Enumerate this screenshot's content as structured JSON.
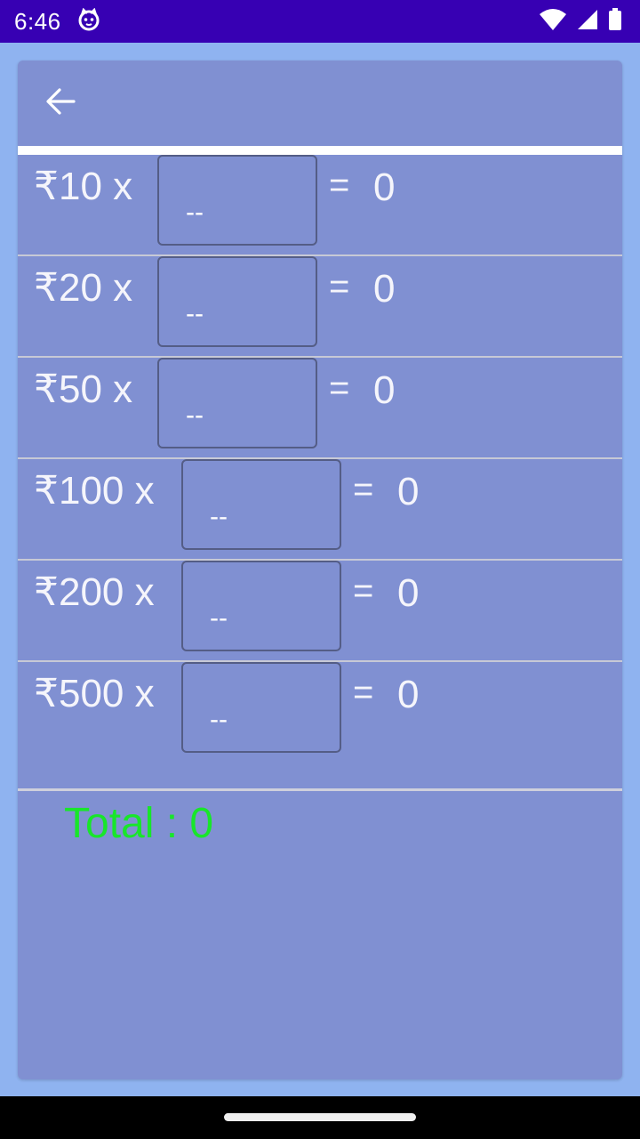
{
  "status_bar": {
    "time": "6:46",
    "icons": [
      "cat-notification-icon",
      "wifi-icon",
      "cellular-signal-icon",
      "battery-icon"
    ]
  },
  "toolbar": {
    "back_icon": "arrow-left-icon"
  },
  "denominations": [
    {
      "label": "₹10 x",
      "placeholder": "--",
      "equals": "=",
      "result": "0"
    },
    {
      "label": "₹20 x",
      "placeholder": "--",
      "equals": "=",
      "result": "0"
    },
    {
      "label": "₹50 x",
      "placeholder": "--",
      "equals": "=",
      "result": "0"
    },
    {
      "label": "₹100 x",
      "placeholder": "--",
      "equals": "=",
      "result": "0"
    },
    {
      "label": "₹200 x",
      "placeholder": "--",
      "equals": "=",
      "result": "0"
    },
    {
      "label": "₹500 x",
      "placeholder": "--",
      "equals": "=",
      "result": "0"
    }
  ],
  "total": {
    "text": "Total : 0"
  },
  "colors": {
    "status_bar": "#3700b3",
    "background": "#8fb3f0",
    "card": "#8090d2",
    "total_text": "#18e62a"
  }
}
